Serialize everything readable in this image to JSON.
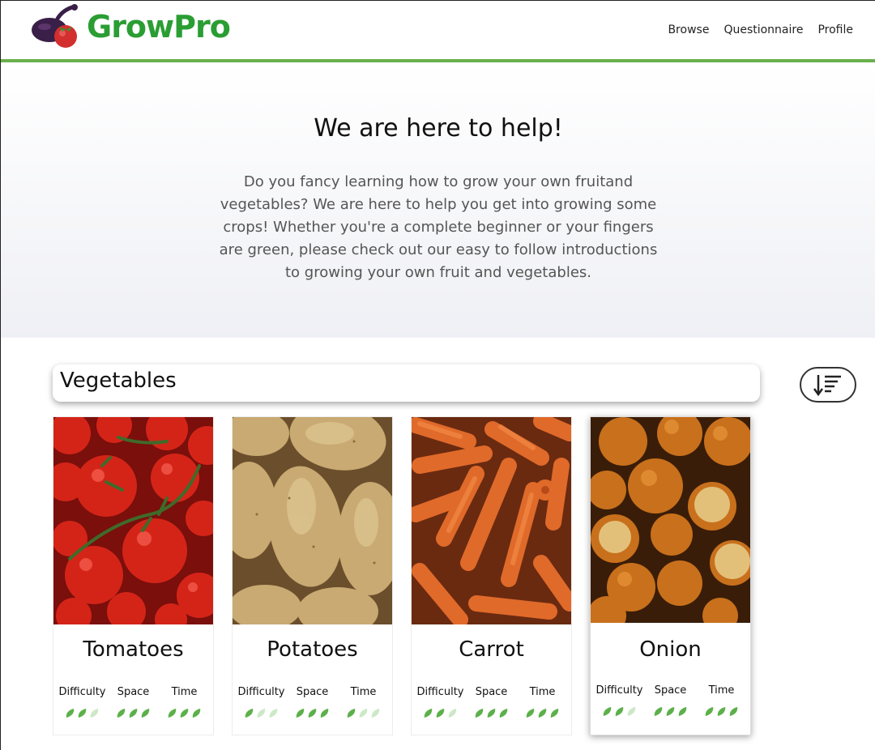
{
  "brand": {
    "name": "GrowPro",
    "accent": "#2a9d33",
    "bar_color": "#6ab04c"
  },
  "nav": [
    {
      "label": "Browse"
    },
    {
      "label": "Questionnaire"
    },
    {
      "label": "Profile"
    }
  ],
  "hero": {
    "title": "We are here to help!",
    "body": "Do you fancy learning how to grow your own fruitand vegetables? We are here to help you get into growing some crops! Whether you're a complete beginner or your fingers are green, please check out our easy to follow introductions to growing your own fruit and vegetables."
  },
  "section": {
    "title": "Vegetables",
    "sort_icon": "sort-descending-icon"
  },
  "stat_labels": {
    "difficulty": "Difficulty",
    "space": "Space",
    "time": "Time"
  },
  "leaf_colors": {
    "filled": "#5cb04a",
    "empty": "#cde8c6"
  },
  "cards": [
    {
      "name": "Tomatoes",
      "image": "tomatoes-photo",
      "difficulty": 2,
      "space": 3,
      "time": 3
    },
    {
      "name": "Potatoes",
      "image": "potatoes-photo",
      "difficulty": 1,
      "space": 3,
      "time": 1
    },
    {
      "name": "Carrot",
      "image": "carrots-photo",
      "difficulty": 2,
      "space": 3,
      "time": 3
    },
    {
      "name": "Onion",
      "image": "onions-photo",
      "difficulty": 2,
      "space": 3,
      "time": 3
    }
  ]
}
